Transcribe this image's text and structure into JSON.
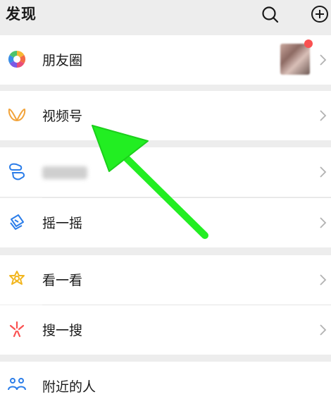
{
  "header": {
    "title": "发现"
  },
  "rows": [
    {
      "label": "朋友圈"
    },
    {
      "label": "视频号"
    },
    {
      "label": "扫一扫",
      "blurred": true
    },
    {
      "label": "摇一摇"
    },
    {
      "label": "看一看"
    },
    {
      "label": "搜一搜"
    },
    {
      "label": "附近的人"
    }
  ],
  "colors": {
    "background": "#ededed",
    "cell": "#ffffff",
    "badge": "#fa5151",
    "annotation_arrow": "#22ee22"
  },
  "icons": [
    "search-icon",
    "add-circle-icon",
    "moments-icon",
    "channels-icon",
    "scan-icon",
    "shake-icon",
    "top-stories-icon",
    "search-feature-icon",
    "nearby-icon",
    "chevron-right-icon"
  ]
}
